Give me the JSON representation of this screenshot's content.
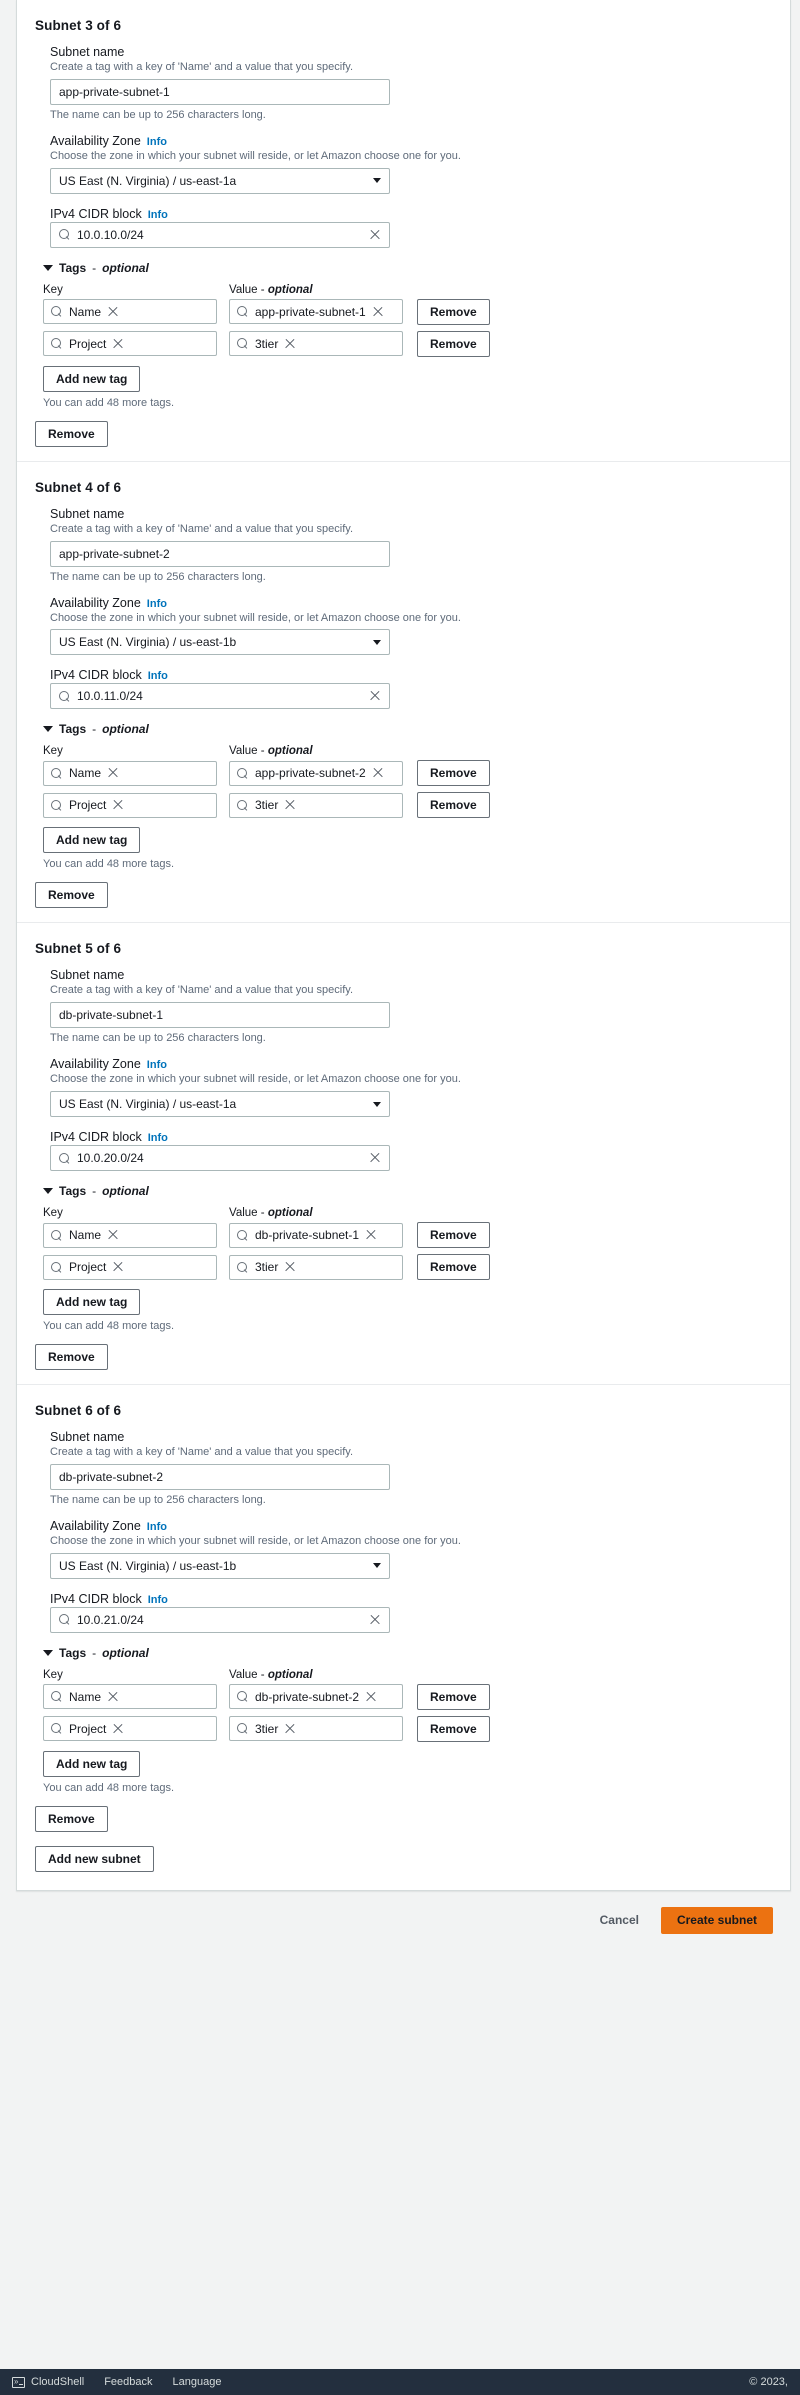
{
  "form": {
    "labels": {
      "subnet_name": "Subnet name",
      "subnet_name_desc": "Create a tag with a key of 'Name' and a value that you specify.",
      "subnet_name_help": "The name can be up to 256 characters long.",
      "availability_zone": "Availability Zone",
      "availability_zone_desc": "Choose the zone in which your subnet will reside, or let Amazon choose one for you.",
      "ipv4_cidr": "IPv4 CIDR block",
      "info": "Info",
      "tags_toggle_label": "Tags",
      "tags_toggle_dash": "-",
      "tags_toggle_optional": "optional",
      "key_header": "Key",
      "value_header": "Value",
      "value_header_dash": "-",
      "value_header_optional": "optional",
      "add_new_tag": "Add new tag",
      "remove": "Remove",
      "tag_limit": "You can add 48 more tags.",
      "add_new_subnet": "Add new subnet"
    },
    "subnets": [
      {
        "title": "Subnet 3 of 6",
        "name": "app-private-subnet-1",
        "az": "US East (N. Virginia) / us-east-1a",
        "cidr": "10.0.10.0/24",
        "tags": [
          {
            "key": "Name",
            "value": "app-private-subnet-1"
          },
          {
            "key": "Project",
            "value": "3tier"
          }
        ]
      },
      {
        "title": "Subnet 4 of 6",
        "name": "app-private-subnet-2",
        "az": "US East (N. Virginia) / us-east-1b",
        "cidr": "10.0.11.0/24",
        "tags": [
          {
            "key": "Name",
            "value": "app-private-subnet-2"
          },
          {
            "key": "Project",
            "value": "3tier"
          }
        ]
      },
      {
        "title": "Subnet 5 of 6",
        "name": "db-private-subnet-1",
        "az": "US East (N. Virginia) / us-east-1a",
        "cidr": "10.0.20.0/24",
        "tags": [
          {
            "key": "Name",
            "value": "db-private-subnet-1"
          },
          {
            "key": "Project",
            "value": "3tier"
          }
        ]
      },
      {
        "title": "Subnet 6 of 6",
        "name": "db-private-subnet-2",
        "az": "US East (N. Virginia) / us-east-1b",
        "cidr": "10.0.21.0/24",
        "tags": [
          {
            "key": "Name",
            "value": "db-private-subnet-2"
          },
          {
            "key": "Project",
            "value": "3tier"
          }
        ]
      }
    ]
  },
  "footer": {
    "cancel": "Cancel",
    "create_subnet": "Create subnet"
  },
  "statusbar": {
    "cloudshell": "CloudShell",
    "feedback": "Feedback",
    "language": "Language",
    "copyright": "© 2023,"
  },
  "colors": {
    "accent_orange": "#ec7211",
    "link_blue": "#0073bb",
    "statusbar_bg": "#232f3e"
  }
}
